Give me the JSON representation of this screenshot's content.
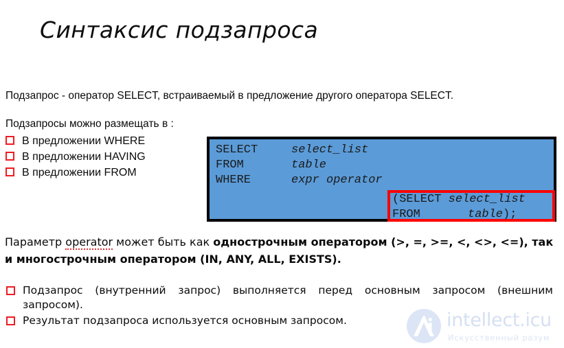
{
  "slide": {
    "title": "Синтаксис подзапроса",
    "intro": "Подзапрос - оператор SELECT, встраиваемый в предложение другого оператора SELECT.",
    "subhead": "Подзапросы можно размещать в :",
    "place_items": [
      {
        "label": "В предложении WHERE"
      },
      {
        "label": "В предложении HAVING"
      },
      {
        "label": "В предложении FROM"
      }
    ],
    "code_box": {
      "background_color": "#5b9bd8",
      "border_color": "#000000",
      "highlight_color": "#ff0000",
      "lines": [
        {
          "keyword": "SELECT",
          "value": "select_list"
        },
        {
          "keyword": "FROM",
          "value": "table"
        },
        {
          "keyword": "WHERE",
          "value": "expr operator"
        }
      ],
      "subquery": {
        "line1": "(SELECT ",
        "line1_value": "select_list",
        "line2_keyword": "FROM",
        "line2_value": "table",
        "line2_tail": ");"
      }
    },
    "operator_para": {
      "part1": "Параметр ",
      "spell_word": "operator",
      "part2": " может быть как ",
      "bold1": "однострочным оператором",
      "part3": " (>, =, >=, <, <>, <=), так и ",
      "bold2": "многострочным оператором",
      "part4": " (IN, ANY, ALL, EXISTS)."
    },
    "bottom_items": [
      {
        "line1": "Подзапрос (внутренний запрос) выполняется перед основным запросом (внешним",
        "line2": "запросом)."
      },
      {
        "line1": "Результат подзапроса используется основным запросом.",
        "line2": ""
      }
    ],
    "watermark": {
      "brand": "intellect.icu",
      "tagline": "Искусственный разум",
      "logo_letters": "Ai",
      "color": "#d6e0f2"
    },
    "bullet_color": "#ed1c24"
  }
}
